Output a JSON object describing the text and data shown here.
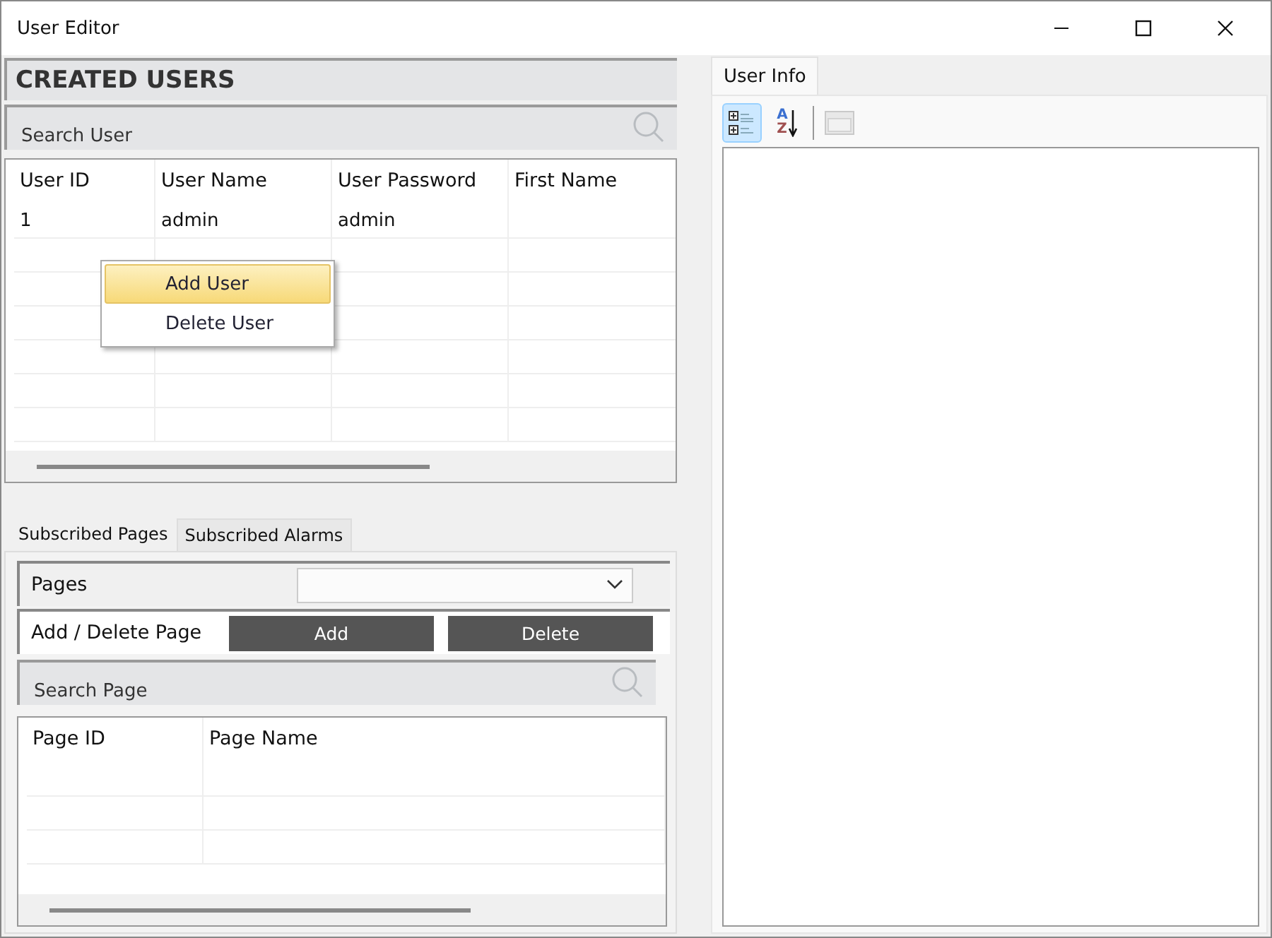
{
  "window": {
    "title": "User Editor"
  },
  "users": {
    "heading": "CREATED USERS",
    "search": {
      "placeholder": "Search User"
    },
    "columns": [
      "User ID",
      "User Name",
      "User Password",
      "First Name"
    ],
    "rows": [
      [
        "1",
        "admin",
        "admin",
        ""
      ]
    ],
    "context_menu": [
      {
        "label": "Add User",
        "selected": true
      },
      {
        "label": "Delete User",
        "selected": false
      }
    ]
  },
  "subscriptions": {
    "tabs": [
      {
        "label": "Subscribed Pages",
        "selected": true
      },
      {
        "label": "Subscribed Alarms",
        "selected": false
      }
    ],
    "pages_label": "Pages",
    "add_delete_label": "Add / Delete Page",
    "buttons": [
      "Add",
      "Delete"
    ],
    "search": {
      "placeholder": "Search Page"
    },
    "columns": [
      "Page ID",
      "Page Name"
    ]
  },
  "info": {
    "tabs": [
      {
        "label": "User Info",
        "selected": true
      }
    ],
    "toolbar": [
      {
        "kind": "categorized",
        "selected": true,
        "disabled": false
      },
      {
        "kind": "alphabetical",
        "selected": false,
        "disabled": false,
        "letters": [
          "A",
          "Z"
        ]
      },
      {
        "kind": "pages",
        "selected": false,
        "disabled": true
      }
    ]
  }
}
